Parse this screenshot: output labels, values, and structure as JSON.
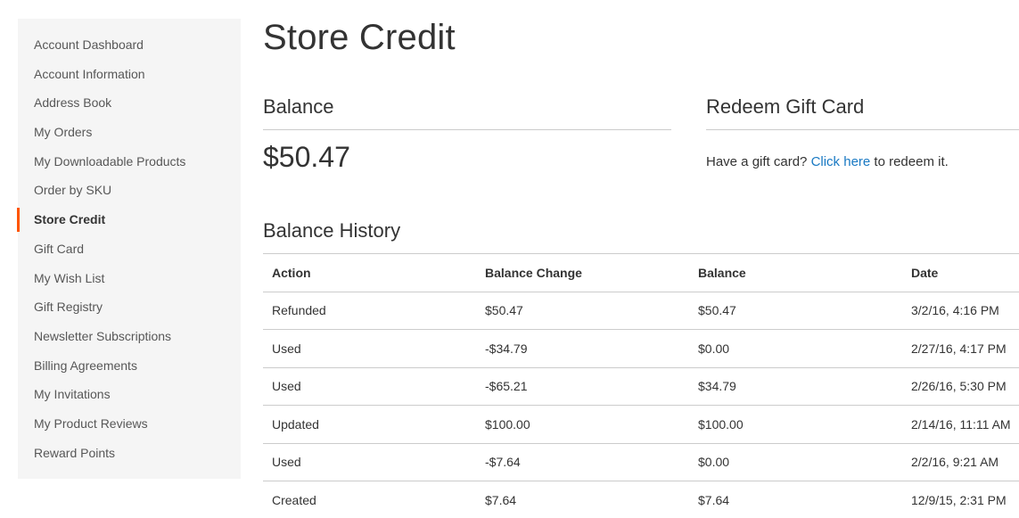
{
  "sidebar": {
    "items": [
      {
        "label": "Account Dashboard",
        "active": false
      },
      {
        "label": "Account Information",
        "active": false
      },
      {
        "label": "Address Book",
        "active": false
      },
      {
        "label": "My Orders",
        "active": false
      },
      {
        "label": "My Downloadable Products",
        "active": false
      },
      {
        "label": "Order by SKU",
        "active": false
      },
      {
        "label": "Store Credit",
        "active": true
      },
      {
        "label": "Gift Card",
        "active": false
      },
      {
        "label": "My Wish List",
        "active": false
      },
      {
        "label": "Gift Registry",
        "active": false
      },
      {
        "label": "Newsletter Subscriptions",
        "active": false
      },
      {
        "label": "Billing Agreements",
        "active": false
      },
      {
        "label": "My Invitations",
        "active": false
      },
      {
        "label": "My Product Reviews",
        "active": false
      },
      {
        "label": "Reward Points",
        "active": false
      }
    ],
    "active_marker_color": "#ff5501"
  },
  "page": {
    "title": "Store Credit"
  },
  "balance": {
    "title": "Balance",
    "amount": "$50.47"
  },
  "redeem": {
    "title": "Redeem Gift Card",
    "text_before": "Have a gift card? ",
    "link_label": "Click here",
    "text_after": " to redeem it.",
    "link_color": "#1979c3"
  },
  "history": {
    "title": "Balance History",
    "columns": [
      "Action",
      "Balance Change",
      "Balance",
      "Date"
    ],
    "rows": [
      [
        "Refunded",
        "$50.47",
        "$50.47",
        "3/2/16, 4:16 PM"
      ],
      [
        "Used",
        "-$34.79",
        "$0.00",
        "2/27/16, 4:17 PM"
      ],
      [
        "Used",
        "-$65.21",
        "$34.79",
        "2/26/16, 5:30 PM"
      ],
      [
        "Updated",
        "$100.00",
        "$100.00",
        "2/14/16, 11:11 AM"
      ],
      [
        "Used",
        "-$7.64",
        "$0.00",
        "2/2/16, 9:21 AM"
      ],
      [
        "Created",
        "$7.64",
        "$7.64",
        "12/9/15, 2:31 PM"
      ]
    ]
  }
}
